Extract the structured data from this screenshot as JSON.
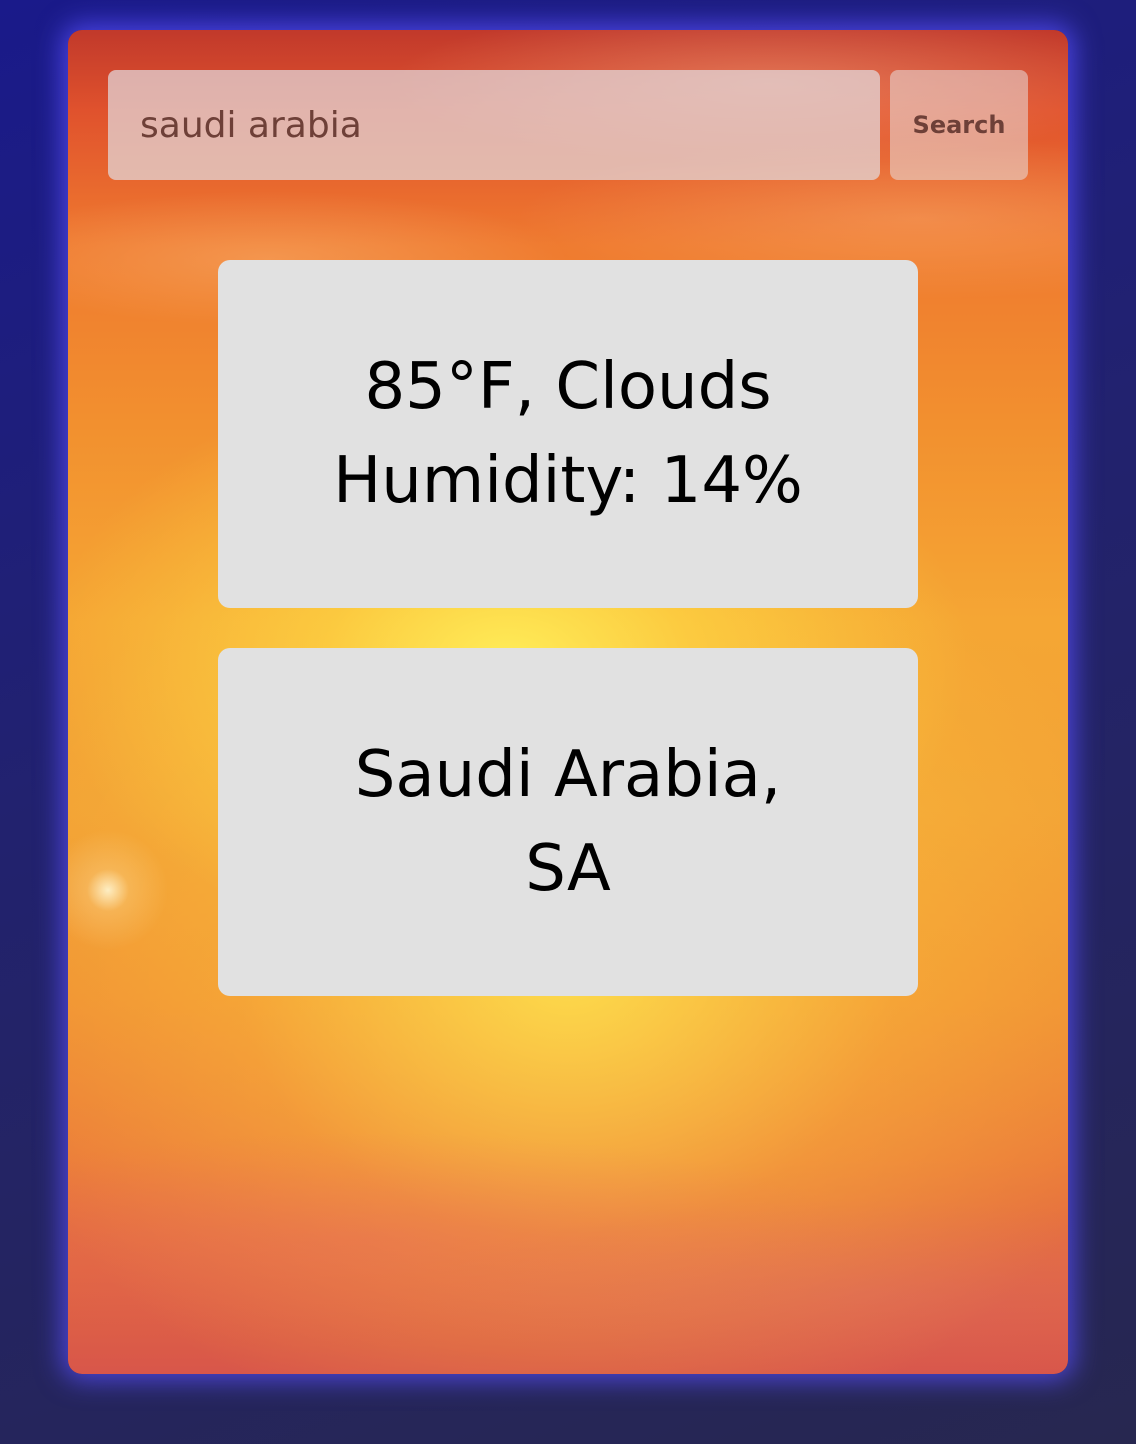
{
  "search": {
    "value": "saudi arabia",
    "button_label": "Search"
  },
  "weather": {
    "summary": "85°F, Clouds",
    "humidity": "Humidity: 14%"
  },
  "location": {
    "line1": "Saudi Arabia,",
    "line2": "SA"
  },
  "colors": {
    "page_background": "#22226e",
    "card_glow": "#5a50ff",
    "panel_background": "#e1e1e1",
    "search_text": "#6e4038"
  }
}
